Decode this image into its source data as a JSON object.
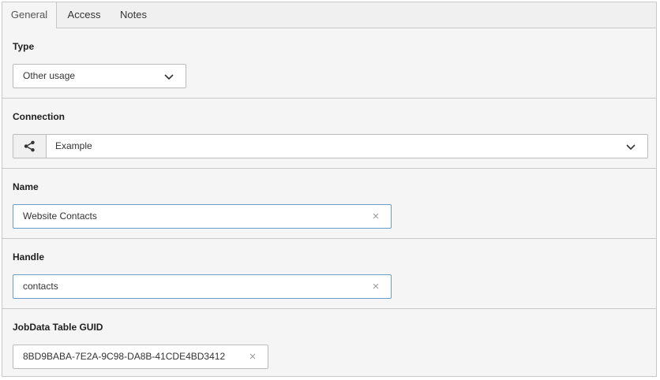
{
  "tabs": {
    "general": "General",
    "access": "Access",
    "notes": "Notes",
    "active": "General"
  },
  "type": {
    "label": "Type",
    "value": "Other usage"
  },
  "connection": {
    "label": "Connection",
    "value": "Example",
    "icon": "share-icon"
  },
  "name": {
    "label": "Name",
    "value": "Website Contacts"
  },
  "handle": {
    "label": "Handle",
    "value": "contacts"
  },
  "guid": {
    "label": "JobData Table GUID",
    "value": "8BD9BABA-7E2A-9C98-DA8B-41CDE4BD3412"
  },
  "icons": {
    "clear": "×"
  },
  "colors": {
    "focus_border": "#6a9ec4",
    "panel_bg": "#f5f5f5",
    "border": "#c8c8c8"
  }
}
